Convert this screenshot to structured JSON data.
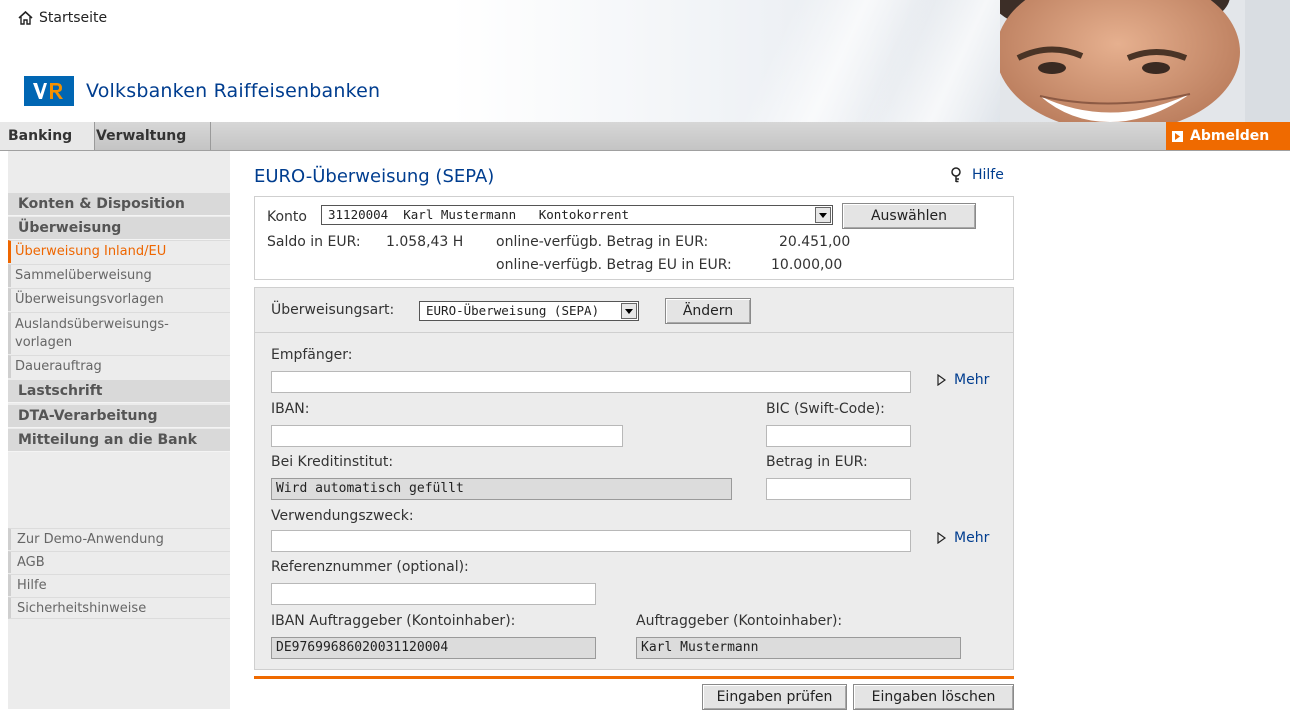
{
  "header": {
    "home_label": "Startseite",
    "brand": "Volksbanken Raiffeisenbanken"
  },
  "nav": {
    "tabs": [
      "Banking",
      "Verwaltung"
    ],
    "logout_label": "Abmelden"
  },
  "sidebar": {
    "items": [
      {
        "label": "Konten & Disposition",
        "kind": "header"
      },
      {
        "label": "Überweisung",
        "kind": "header"
      },
      {
        "label": "Überweisung Inland/EU",
        "kind": "item",
        "active": true
      },
      {
        "label": "Sammelüberweisung",
        "kind": "item"
      },
      {
        "label": "Überweisungsvorlagen",
        "kind": "item"
      },
      {
        "label": "Auslandsüberweisungs-\nvorlagen",
        "kind": "item"
      },
      {
        "label": "Dauerauftrag",
        "kind": "item"
      },
      {
        "label": "Lastschrift",
        "kind": "header"
      },
      {
        "label": "DTA-Verarbeitung",
        "kind": "header"
      },
      {
        "label": "Mitteilung an die Bank",
        "kind": "header"
      }
    ],
    "footer_links": [
      "Zur Demo-Anwendung",
      "AGB",
      "Hilfe",
      "Sicherheitshinweise"
    ]
  },
  "main": {
    "title": "EURO-Überweisung (SEPA)",
    "help_label": "Hilfe",
    "account": {
      "label": "Konto",
      "selected": "31120004  Karl Mustermann   Kontokorrent",
      "select_button": "Auswählen",
      "saldo_label": "Saldo in EUR:",
      "saldo_value": "1.058,43 H",
      "online_label": "online-verfügb. Betrag in EUR:",
      "online_value": "20.451,00",
      "online_eu_label": "online-verfügb. Betrag EU in EUR:",
      "online_eu_value": "10.000,00"
    },
    "transfer_type": {
      "label": "Überweisungsart:",
      "selected": "EURO-Überweisung (SEPA)",
      "change_button": "Ändern"
    },
    "form": {
      "recipient_label": "Empfänger:",
      "recipient_value": "",
      "more_label": "Mehr",
      "iban_label": "IBAN:",
      "iban_value": "",
      "bic_label": "BIC (Swift-Code):",
      "bic_value": "",
      "bank_label": "Bei Kreditinstitut:",
      "bank_value": "Wird automatisch gefüllt",
      "amount_label": "Betrag in EUR:",
      "amount_value": "",
      "purpose_label": "Verwendungszweck:",
      "purpose_value": "",
      "reference_label": "Referenznummer (optional):",
      "reference_value": "",
      "payer_iban_label": "IBAN Auftraggeber (Kontoinhaber):",
      "payer_iban_value": "DE97699686020031120004",
      "payer_label": "Auftraggeber (Kontoinhaber):",
      "payer_value": "Karl Mustermann"
    },
    "buttons": {
      "check": "Eingaben prüfen",
      "clear": "Eingaben löschen"
    }
  },
  "colors": {
    "accent_orange": "#ef6a00",
    "brand_blue": "#003d8f",
    "logo_blue": "#0066b3"
  }
}
